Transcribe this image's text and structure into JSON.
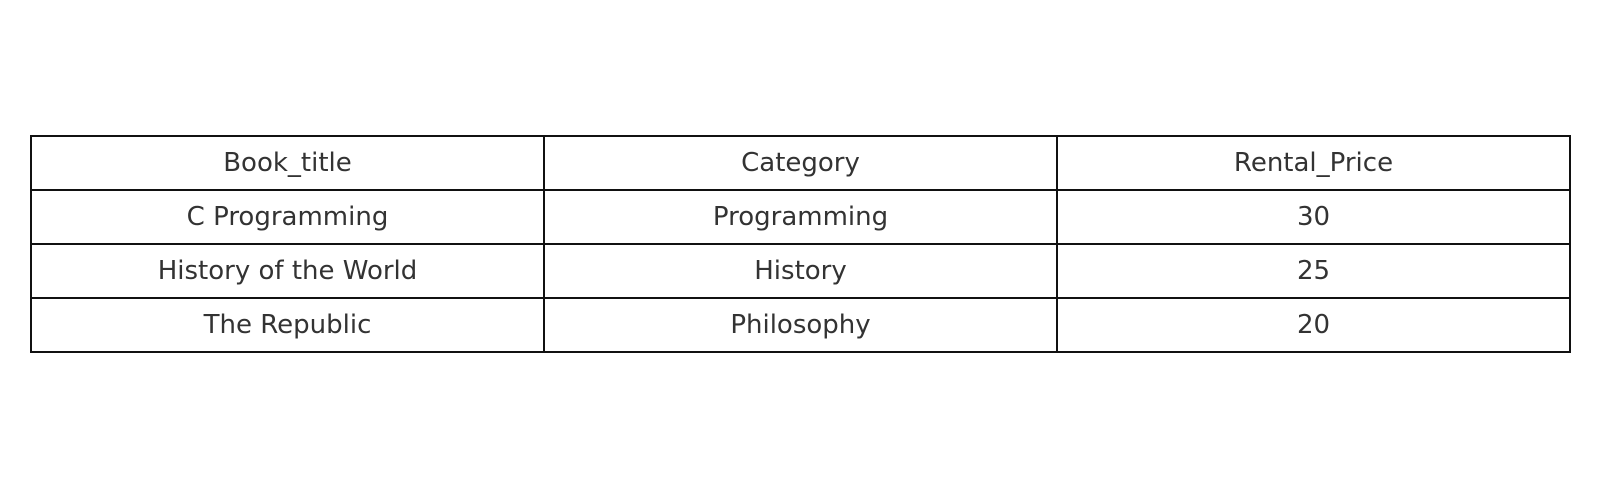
{
  "chart_data": {
    "type": "table",
    "columns": [
      "Book_title",
      "Category",
      "Rental_Price"
    ],
    "rows": [
      [
        "C Programming",
        "Programming",
        "30"
      ],
      [
        "History of the World",
        "History",
        "25"
      ],
      [
        "The Republic",
        "Philosophy",
        "20"
      ]
    ]
  },
  "colors": {
    "border": "#111111",
    "text": "#333333",
    "background": "#ffffff"
  }
}
